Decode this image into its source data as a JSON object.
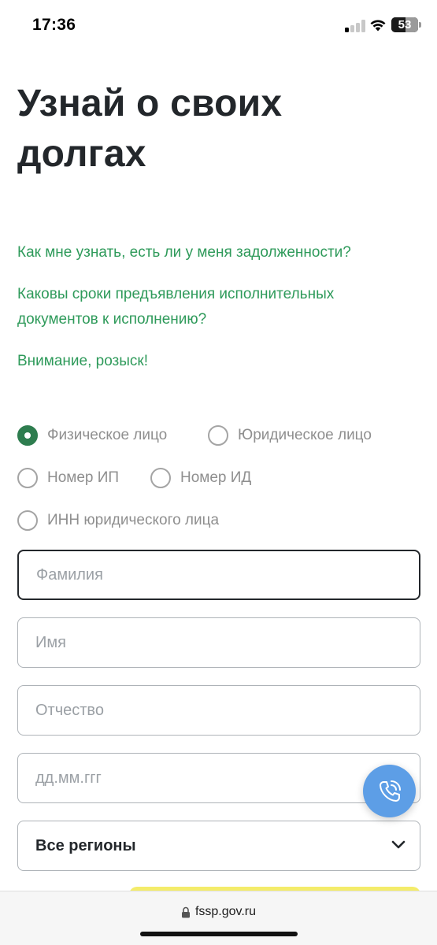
{
  "status_bar": {
    "time": "17:36",
    "battery": "53",
    "battery_level_percent": 53
  },
  "page": {
    "title": "Узнай о своих долгах"
  },
  "links": [
    "Как мне узнать, есть ли у меня задолженности?",
    "Каковы сроки предъявления исполнительных документов к исполнению?",
    "Внимание, розыск!"
  ],
  "search_type": {
    "options": [
      "Физическое лицо",
      "Юридическое лицо",
      "Номер ИП",
      "Номер ИД",
      "ИНН юридического лица"
    ],
    "selected": "Физическое лицо"
  },
  "form": {
    "last_name_placeholder": "Фамилия",
    "first_name_placeholder": "Имя",
    "patronymic_placeholder": "Отчество",
    "birth_date_placeholder": "дд.мм.ггг",
    "region_value": "Все регионы"
  },
  "browser": {
    "url": "fssp.gov.ru"
  },
  "colors": {
    "accent_green": "#2e9a5a",
    "radio_checked": "#2e7d4f",
    "call_button": "#5d9ee6",
    "submit_yellow": "#f4ec6a"
  },
  "icons": {
    "call": "phone-call-icon",
    "chevron": "chevron-down-icon",
    "lock": "lock-icon",
    "wifi": "wifi-icon",
    "signal": "cellular-signal-icon",
    "battery": "battery-icon"
  }
}
